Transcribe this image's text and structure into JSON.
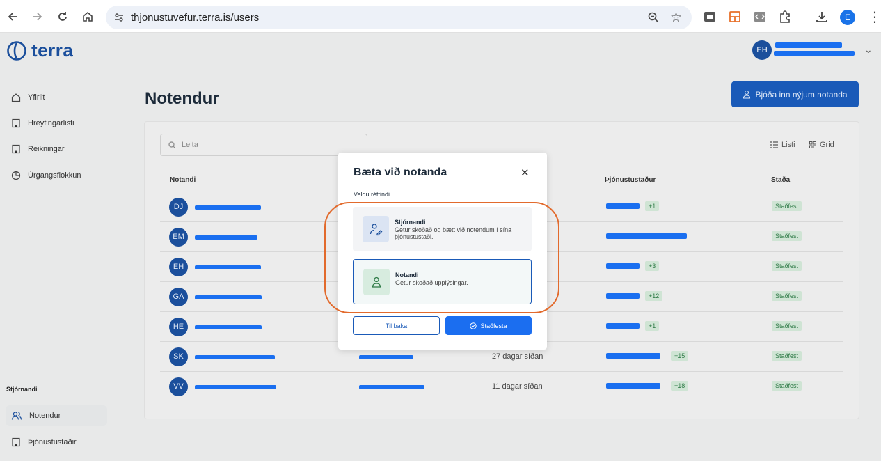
{
  "browser": {
    "url": "thjonustuvefur.terra.is/users",
    "profile_initial": "E"
  },
  "app": {
    "logo_text": "terra",
    "user_initials": "EH"
  },
  "sidebar": {
    "items": [
      {
        "label": "Yfirlit",
        "icon": "home-icon"
      },
      {
        "label": "Hreyfingarlisti",
        "icon": "building-icon"
      },
      {
        "label": "Reikningar",
        "icon": "building-icon"
      },
      {
        "label": "Úrgangsflokkun",
        "icon": "pie-chart-icon"
      }
    ],
    "section_label": "Stjórnandi",
    "admin_items": [
      {
        "label": "Notendur",
        "icon": "users-icon"
      },
      {
        "label": "Þjónustustaðir",
        "icon": "building-icon"
      }
    ]
  },
  "main": {
    "title": "Notendur",
    "invite_label": "Bjóða inn nýjum notanda",
    "search_placeholder": "Leita",
    "view_list": "Listi",
    "view_grid": "Grid",
    "columns": {
      "user": "Notandi",
      "service": "Þjónustustaður",
      "status": "Staða"
    },
    "rows": [
      {
        "initials": "DJ",
        "time": "",
        "more": "+1",
        "status": "Staðfest"
      },
      {
        "initials": "EM",
        "time": "",
        "more": "",
        "status": "Staðfest"
      },
      {
        "initials": "EH",
        "time": "",
        "more": "+3",
        "status": "Staðfest"
      },
      {
        "initials": "GA",
        "time": "",
        "more": "+12",
        "status": "Staðfest"
      },
      {
        "initials": "HE",
        "time": "",
        "more": "+1",
        "status": "Staðfest"
      },
      {
        "initials": "SK",
        "time": "27 dagar síðan",
        "more": "+15",
        "status": "Staðfest"
      },
      {
        "initials": "VV",
        "time": "11 dagar síðan",
        "more": "+18",
        "status": "Staðfest"
      }
    ]
  },
  "modal": {
    "title": "Bæta við notanda",
    "subtitle": "Veldu réttindi",
    "options": [
      {
        "title": "Stjórnandi",
        "desc": "Getur skoðað og bætt við notendum í sína þjónustustaði."
      },
      {
        "title": "Notandi",
        "desc": "Getur skoðað upplýsingar."
      }
    ],
    "back_label": "Til baka",
    "confirm_label": "Staðfesta"
  },
  "colors": {
    "brand": "#1b4f9c",
    "primary_button": "#1b6ef0",
    "highlight": "#e26a2c",
    "status_bg": "#cfe4d4"
  }
}
